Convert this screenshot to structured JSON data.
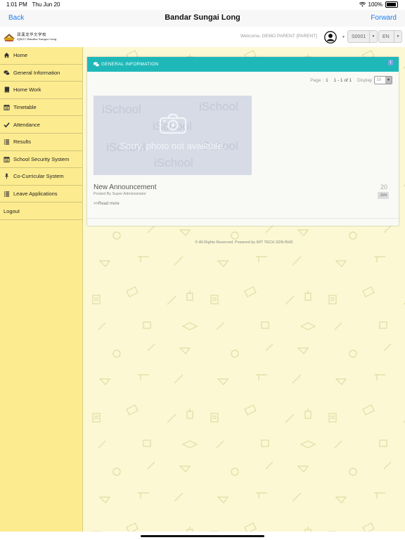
{
  "status_bar": {
    "time": "1:01 PM",
    "date": "Thu Jun 20",
    "battery": "100%"
  },
  "nav": {
    "back_label": "Back",
    "title": "Bandar Sungai Long",
    "forward_label": "Forward"
  },
  "header": {
    "logo_text_line1": "双溪龙华文学校",
    "logo_text_line2": "SJK(C) Bandar Sungai Long",
    "welcome": "Welcome, DEMO PARENT [PARENT]",
    "student_code": "S0001",
    "language": "EN"
  },
  "sidebar": {
    "items": [
      {
        "label": "Home",
        "icon": "home-icon"
      },
      {
        "label": "General Information",
        "icon": "comments-icon"
      },
      {
        "label": "Home Work",
        "icon": "book-icon"
      },
      {
        "label": "Timetable",
        "icon": "calendar-icon"
      },
      {
        "label": "Attendance",
        "icon": "check-icon"
      },
      {
        "label": "Results",
        "icon": "list-icon"
      },
      {
        "label": "School Security System",
        "icon": "calendar-icon"
      },
      {
        "label": "Co-Curricular System",
        "icon": "pin-icon"
      },
      {
        "label": "Leave Applications",
        "icon": "list-icon"
      },
      {
        "label": "Logout",
        "icon": ""
      }
    ]
  },
  "panel": {
    "title": "GENERAL INFORMATION",
    "badge": "1",
    "pager": {
      "page_label": "Page :",
      "page": "1",
      "range": "1 - 1 of 1",
      "display_label": "Display",
      "display_value": "10"
    },
    "photo": {
      "watermark": "iSchool",
      "message": "Sorry, photo not available."
    },
    "announcement": {
      "title": "New Announcement",
      "posted_by": "Posted By Super Administrator",
      "read_more": ">>Read more",
      "day": "20",
      "month": "JUN"
    }
  },
  "footer": {
    "text": "© All Rights Reserved. Powered by IMT TECH SDN BHD"
  },
  "colors": {
    "accent": "#1a7cf5",
    "panel_header": "#1fb8b9",
    "sidebar_bg": "#fdec8f",
    "main_bg": "#fbf8d3"
  }
}
